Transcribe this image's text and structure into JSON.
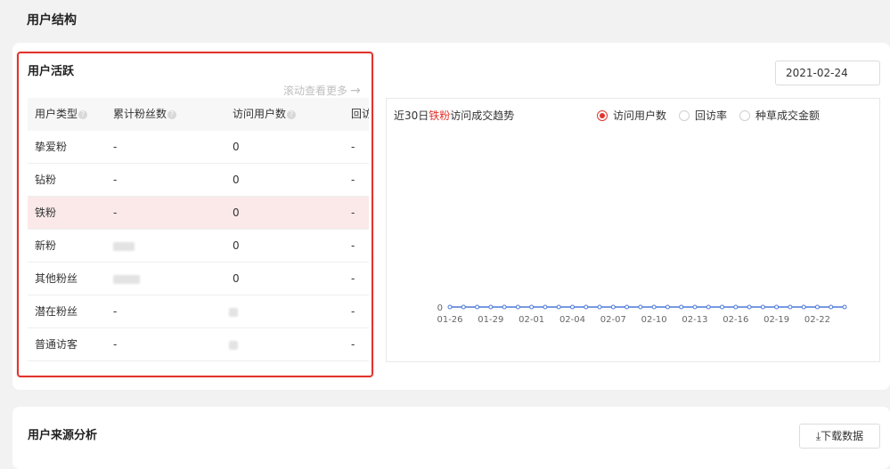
{
  "page": {
    "title": "用户结构"
  },
  "user_activity": {
    "title": "用户活跃",
    "scroll_hint": "滚动查看更多",
    "headers": [
      "用户类型",
      "累计粉丝数",
      "访问用户数",
      "回访"
    ],
    "rows": [
      {
        "type": "挚爱粉",
        "fans": "-",
        "visitors": "0",
        "revisit": "-"
      },
      {
        "type": "钻粉",
        "fans": "-",
        "visitors": "0",
        "revisit": "-"
      },
      {
        "type": "铁粉",
        "fans": "-",
        "visitors": "0",
        "revisit": "-",
        "selected": true
      },
      {
        "type": "新粉",
        "fans": "",
        "visitors": "0",
        "revisit": "-"
      },
      {
        "type": "其他粉丝",
        "fans": "",
        "visitors": "0",
        "revisit": "-"
      },
      {
        "type": "潜在粉丝",
        "fans": "-",
        "visitors": "",
        "revisit": "-"
      },
      {
        "type": "普通访客",
        "fans": "-",
        "visitors": "",
        "revisit": "-"
      }
    ]
  },
  "date": "2021-02-24",
  "trend": {
    "title_prefix": "近30日",
    "title_highlight": "铁粉",
    "title_suffix": "访问成交趋势",
    "metrics": [
      {
        "label": "访问用户数",
        "selected": true
      },
      {
        "label": "回访率",
        "selected": false
      },
      {
        "label": "种草成交金额",
        "selected": false
      }
    ]
  },
  "chart_data": {
    "type": "line",
    "x_tick_labels": [
      "01-26",
      "01-29",
      "02-01",
      "02-04",
      "02-07",
      "02-10",
      "02-13",
      "02-16",
      "02-19",
      "02-22"
    ],
    "y_tick_labels": [
      "0"
    ],
    "series": [
      {
        "values": [
          0,
          0,
          0,
          0,
          0,
          0,
          0,
          0,
          0,
          0,
          0,
          0,
          0,
          0,
          0,
          0,
          0,
          0,
          0,
          0,
          0,
          0,
          0,
          0,
          0,
          0,
          0,
          0,
          0,
          0
        ]
      }
    ],
    "color": "#4a78d8"
  },
  "source_section": {
    "title": "用户来源分析",
    "download_label": "下载数据"
  }
}
